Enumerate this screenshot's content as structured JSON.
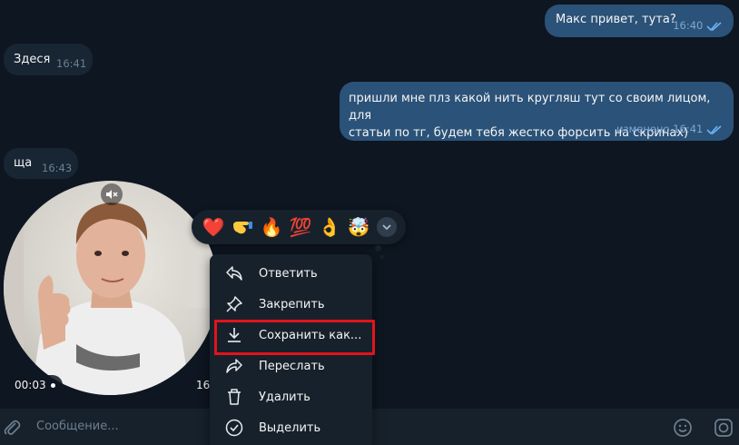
{
  "messages": [
    {
      "dir": "out",
      "text": "Макс привет, тута?",
      "time": "16:40"
    },
    {
      "dir": "in",
      "text": "Здеся",
      "time": "16:41"
    },
    {
      "dir": "out",
      "text_line1": "пришли мне плз какой нить кругляш тут со своим лицом, для",
      "text_line2": "статьи по тг, будем тебя жестко форсить на скринах)",
      "edited": "изменено",
      "time": "16:41"
    },
    {
      "dir": "in",
      "text": "ща",
      "time": "16:43"
    }
  ],
  "video_message": {
    "duration": "00:03",
    "time_partial": "16"
  },
  "reactions": [
    "❤️",
    "🫲",
    "🔥",
    "💯",
    "👌",
    "🤯"
  ],
  "context_menu": {
    "items": [
      {
        "label": "Ответить",
        "icon": "reply-icon"
      },
      {
        "label": "Закрепить",
        "icon": "pin-icon"
      },
      {
        "label": "Сохранить как...",
        "icon": "download-icon",
        "highlighted": true
      },
      {
        "label": "Переслать",
        "icon": "forward-icon"
      },
      {
        "label": "Удалить",
        "icon": "trash-icon"
      },
      {
        "label": "Выделить",
        "icon": "select-check-icon"
      }
    ]
  },
  "composer": {
    "placeholder": "Сообщение..."
  },
  "colors": {
    "background": "#0e1621",
    "outgoing_bubble": "#2b5278",
    "incoming_bubble": "#182533",
    "panel": "#17212b",
    "highlight_box": "#e1141b"
  }
}
